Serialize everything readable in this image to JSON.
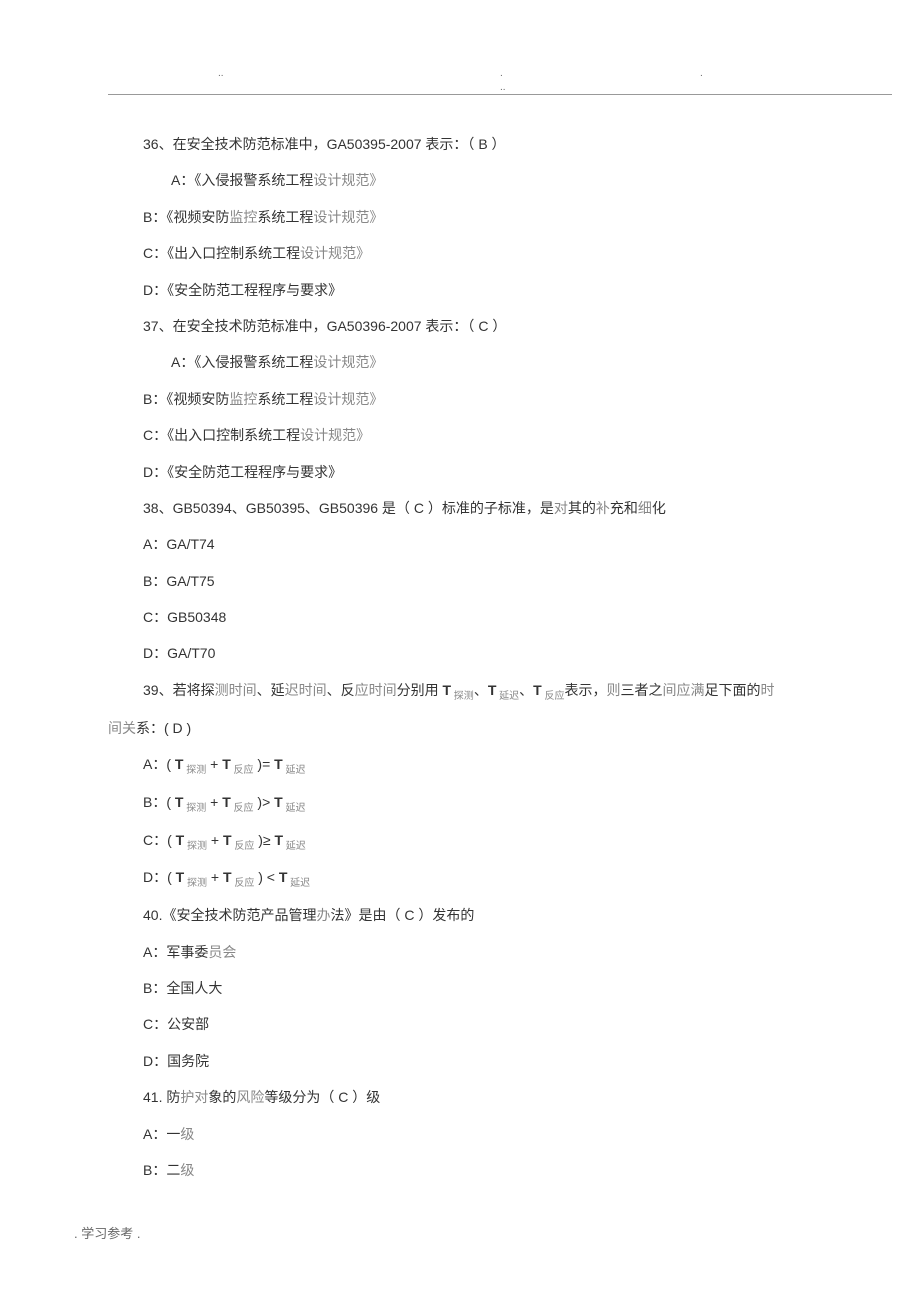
{
  "header": {
    "mark1": "..",
    "mark2": ".",
    "mark3": ".",
    "mark4": ".."
  },
  "q36": {
    "stem": "36、在安全技术防范标准中，GA50395-2007 表示：（  B  ）",
    "a": "A：《入侵报警系统工程",
    "a_gray": "设计规范》",
    "b": "B：《视频安防",
    "b_gray1": "监控",
    "b_mid": "系统工程",
    "b_gray2": "设计规范》",
    "c": "C：《出入口控制系统工程",
    "c_gray": "设计规范》",
    "d": "D：《安全防范工程程序与要求》"
  },
  "q37": {
    "stem": "37、在安全技术防范标准中，GA50396-2007 表示：（  C  ）",
    "a": "A：《入侵报警系统工程",
    "a_gray": "设计规范》",
    "b": "B：《视频安防",
    "b_gray1": "监控",
    "b_mid": "系统工程",
    "b_gray2": "设计规范》",
    "c": "C：《出入口控制系统工程",
    "c_gray": "设计规范》",
    "d": "D：《安全防范工程程序与要求》"
  },
  "q38": {
    "stem": "38、GB50394、GB50395、GB50396 是（  C  ）标准的子标准，是",
    "stem_gray1": "对",
    "stem_mid": "其的",
    "stem_gray2": "补",
    "stem_end": "充和",
    "stem_gray3": "细",
    "stem_end2": "化",
    "a": "A：GA/T74",
    "b": "B：GA/T75",
    "c": "C：GB50348",
    "d": "D：GA/T70"
  },
  "q39": {
    "stem_p1": "39、若将探",
    "stem_g1": "测时间",
    "stem_p2": "、延",
    "stem_g2": "迟时间",
    "stem_p3": "、反",
    "stem_g3": "应时间",
    "stem_p4": "分别用 ",
    "stem_t": "T",
    "sub1": " 探测",
    "sep1": "、",
    "sub2": " 延迟",
    "sep2": "、",
    "sub3": " 反应",
    "stem_p5": "表示，",
    "stem_g4": "则",
    "stem_p6": "三者之",
    "stem_g5": "间应满",
    "stem_p7": "足下面的",
    "stem_g6": "时",
    "line2_g": "间关",
    "line2": "系：( D )",
    "a": "A：( ",
    "b": "B：( ",
    "c": "C：( ",
    "d": "D：( ",
    "plus": " + ",
    "eq": " )= ",
    "gt": " )> ",
    "ge": " )≥ ",
    "lt": " ) < ",
    "sub_tc": " 探测",
    "sub_fy": " 反应",
    "sub_yc": " 延迟"
  },
  "q40": {
    "stem": "40.《安全技术防范产品管理",
    "stem_gray": "办",
    "stem_end": "法》是由（  C  ）发布的",
    "a": "A：军事委",
    "a_gray": "员会",
    "b": "B：全国人大",
    "c": "C：公安部",
    "d": "D：国务院"
  },
  "q41": {
    "stem": "41. 防",
    "stem_gray1": "护对",
    "stem_mid": "象的",
    "stem_gray2": "风险",
    "stem_end": "等级分为（  C  ）级",
    "a": "A：一",
    "a_gray": "级",
    "b": "B：二",
    "b_gray": "级"
  },
  "footer": ".  学习参考        ."
}
